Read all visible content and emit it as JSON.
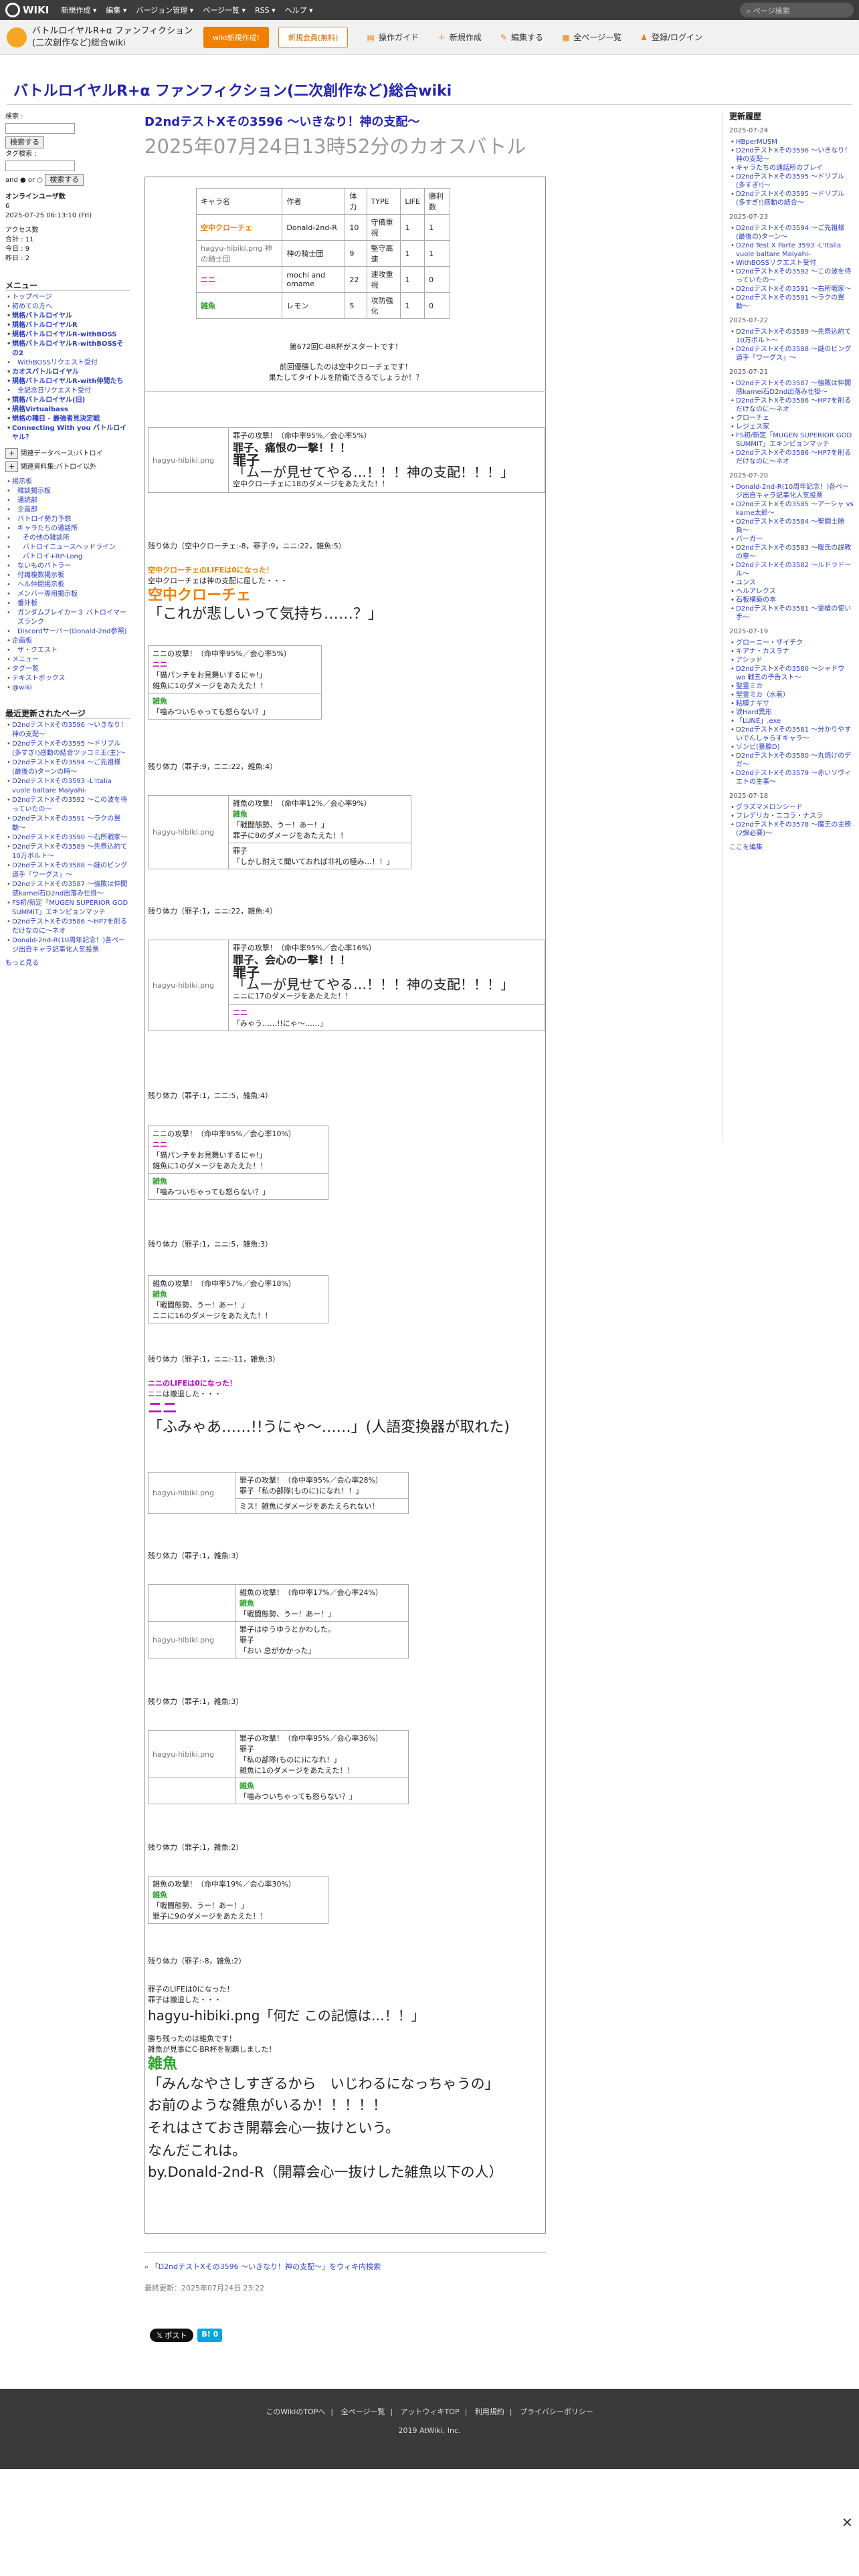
{
  "topbar": {
    "logo": "WIKI",
    "menus": [
      "新規作成 ▾",
      "編集 ▾",
      "バージョン管理 ▾",
      "ページ一覧 ▾",
      "RSS ▾",
      "ヘルプ ▾"
    ],
    "search_placeholder": "ページ検索"
  },
  "header": {
    "site_title": "バトルロイヤルR+α ファンフィクション(二次創作など)総合wiki",
    "btn_new": "wiki新規作成!",
    "btn_member": "新規会員(無料)",
    "nav": [
      "操作ガイド",
      "新規作成",
      "編集する",
      "全ページ一覧",
      "登録/ログイン"
    ]
  },
  "wiki_title": "バトルロイヤルR+α ファンフィクション(二次創作など)総合wiki",
  "sidebar": {
    "search_label": "検索 :",
    "search_btn": "検索する",
    "tag_label": "タグ検索 :",
    "and_or": "and ● or ○",
    "tag_btn": "検索する",
    "online_title": "オンラインユーザ数",
    "online_count": "6",
    "online_time": "2025-07-25 06:13:10 (Fri)",
    "access_title": "アクセス数",
    "access": [
      "合計 : 11",
      "今日 : 9",
      "昨日 : 2"
    ],
    "menu_title": "メニュー",
    "menu": [
      {
        "t": "トップページ",
        "c": ""
      },
      {
        "t": "初めての方へ",
        "c": ""
      },
      {
        "t": "規格バトルロイヤル",
        "c": "b"
      },
      {
        "t": "規格バトルロイヤルR",
        "c": "b"
      },
      {
        "t": "規格バトルロイヤルR-withBOSS",
        "c": "b"
      },
      {
        "t": "規格バトルロイヤルR-withBOSSその2",
        "c": "b"
      },
      {
        "t": "WithBOSSリクエスト受付",
        "c": "sub"
      },
      {
        "t": "カオスバトルロイヤル",
        "c": "b"
      },
      {
        "t": "規格バトルロイヤルR-with仲間たち",
        "c": "b"
      },
      {
        "t": "全記念日リクエスト受付",
        "c": "sub"
      },
      {
        "t": "規格バトルロイヤル(旧)",
        "c": "b"
      },
      {
        "t": "規格Virtualbass",
        "c": "b"
      },
      {
        "t": "規格の種目 - 最強者見決定戦",
        "c": "b"
      },
      {
        "t": "Connecting With you バトルロイヤル？",
        "c": "b"
      }
    ],
    "menu2": [
      "関連データベース:バトロイ",
      "関連資料集:バトロイ以外"
    ],
    "menu3": [
      {
        "t": "掲示板",
        "c": ""
      },
      {
        "t": "雑談掲示板",
        "c": "sub"
      },
      {
        "t": "通読部",
        "c": "sub"
      },
      {
        "t": "企画部",
        "c": "sub"
      },
      {
        "t": "バトロイ勢力予想",
        "c": "sub"
      },
      {
        "t": "キャラたちの通話所",
        "c": "sub"
      },
      {
        "t": "その他の雑談所",
        "c": "sub2"
      },
      {
        "t": "バトロイニュースヘッドライン",
        "c": "sub2"
      },
      {
        "t": "バトロイ+RP-Long",
        "c": "sub2"
      },
      {
        "t": "ないものバトラー",
        "c": "sub"
      },
      {
        "t": "付識複数掲示板",
        "c": "sub"
      },
      {
        "t": "ヘル仲間掲示板",
        "c": "sub"
      },
      {
        "t": "メンバー専用掲示板",
        "c": "sub"
      },
      {
        "t": "番外板",
        "c": "sub"
      },
      {
        "t": "ガンダムブレイカー３ バトロイマーズランク",
        "c": "sub"
      },
      {
        "t": "Discordサーバー(Donald-2nd参照)",
        "c": "sub"
      },
      {
        "t": "企画板",
        "c": ""
      },
      {
        "t": "ザ・クエスト",
        "c": "sub"
      },
      {
        "t": "メニュー",
        "c": ""
      },
      {
        "t": "タグ一覧",
        "c": ""
      },
      {
        "t": "テキストボックス",
        "c": ""
      },
      {
        "t": "@wiki",
        "c": ""
      }
    ],
    "recent_title": "最近更新されたページ",
    "recent": [
      "D2ndテストXその3596 〜いきなり！神の支配〜",
      "D2ndテストXその3595 〜ドリブル(多すぎ!)感動の結合ツッコミ王(主)〜",
      "D2ndテストXその3594 〜ご先祖様(最後の)ターンの時〜",
      "D2ndテストXその3593 -L'Italia vuole baltare Maiyahi-",
      "D2ndテストXその3592 〜この波を待っていたの〜",
      "D2ndテストXその3591 〜ラクの翼動〜",
      "D2ndテストXその3590 〜右所戦家〜",
      "D2ndテストXその3589 〜先祭込約て 10万ボルト〜",
      "D2ndテストXその3588 〜謎のビング道手「ワーグス」〜",
      "D2ndテストXその3587 〜強敗は仲間感kamei石D2nd出落み仕掛〜",
      "FS初/新定「MUGEN SUPERIOR GOD SUMMIT」エキンピョンマッチ",
      "D2ndテストXその3586 〜HP7を削るだけなのに〜ネオ",
      "Donald-2nd-R(10周年記念！)各ページ出自キャラ記事化人気投票"
    ],
    "more": "もっと見る"
  },
  "page": {
    "title": "D2ndテストXその3596 〜いきなり！神の支配〜",
    "subtitle": "2025年07月24日13時52分のカオスバトル"
  },
  "table": {
    "headers": [
      "キャラ名",
      "作者",
      "体力",
      "TYPE",
      "LIFE",
      "勝利数"
    ],
    "rows": [
      [
        "空中クローチェ",
        "Donald-2nd-R",
        "10",
        "守備重視",
        "1",
        "1"
      ],
      [
        "hagyu-hibiki.png 神の騎士団",
        "神の騎士団",
        "9",
        "堅守高速",
        "1",
        "1"
      ],
      [
        "ニニ",
        "mochi and omame",
        "22",
        "速攻重視",
        "1",
        "0"
      ],
      [
        "雑魚",
        "レモン",
        "5",
        "攻防強化",
        "1",
        "0"
      ]
    ]
  },
  "intro": [
    "第672回C-BR杯がスタートです！",
    "前回優勝したのは空中クローチェです！",
    "果たしてタイトルを防衛できるでしょうか！？"
  ],
  "log": {
    "b1_a": "罪子の攻撃！（命中率95%／会心率5%）",
    "b1_b": "罪子、痛恨の一撃！！！",
    "b1_c": "罪子",
    "b1_d": "「ムーが見せてやる…！！！神の支配！！！」",
    "b1_e": "空中クローチェに18のダメージをあたえた！！",
    "r1": "残り体力（空中クローチェ:-8，罪子:9，ニニ:22，雑魚:5）",
    "d1": "空中クローチェのLIFEは0になった！",
    "d2": "空中クローチェは神の支配に屈した・・・",
    "d3": "空中クローチェ",
    "d4": "「これが悲しいって気持ち……？」",
    "b2_a": "ニニの攻撃！（命中率95%／会心率5%）",
    "b2_b": "ニニ",
    "b2_c": "「猫パンチをお見舞いするにゃ!」",
    "b2_d": "雑魚に1のダメージをあたえた！！",
    "b2_e": "雑魚",
    "b2_f": "「噛みついちゃっても怒らない？」",
    "r2": "残り体力（罪子:9，ニニ:22，雑魚:4）",
    "b3_a": "雑魚の攻撃！（命中率12%／会心率9%）",
    "b3_b": "雑魚",
    "b3_c": "「戦闘態勢、うー！あー！」",
    "b3_d": "罪子に8のダメージをあたえた！！",
    "b3_e": "罪子",
    "b3_f": "「しかし耐えて聞いておれば非礼の極み…！！」",
    "r3": "残り体力（罪子:1，ニニ:22，雑魚:4）",
    "b4_a": "罪子の攻撃！（命中率95%／会心率16%）",
    "b4_b": "罪子、会心の一撃！！！",
    "b4_c": "罪子",
    "b4_d": "「ムーが見せてやる…！！！神の支配！！！」",
    "b4_e": "ニニに17のダメージをあたえた！！",
    "b4_f": "ニニ",
    "b4_g": "「みゃう……!!にゃ〜……」",
    "r4": "残り体力（罪子:1，ニニ:5，雑魚:4）",
    "b5_a": "ニニの攻撃！（命中率95%／会心率10%）",
    "b5_b": "ニニ",
    "b5_c": "「猫パンチをお見舞いするにゃ!」",
    "b5_d": "雑魚に1のダメージをあたえた！！",
    "b5_e": "雑魚",
    "b5_f": "「噛みついちゃっても怒らない？」",
    "r5": "残り体力（罪子:1，ニニ:5，雑魚:3）",
    "b6_a": "雑魚の攻撃！（命中率57%／会心率18%）",
    "b6_b": "雑魚",
    "b6_c": "「戦闘態勢、うー！あー！」",
    "b6_d": "ニニに16のダメージをあたえた！！",
    "r6": "残り体力（罪子:1，ニニ:-11，雑魚:3）",
    "d5": "ニニのLIFEは0になった！",
    "d6": "ニニは撤退した・・・",
    "d7": "ニニ",
    "d8": "「ふみゃあ……!!うにゃ〜……」(人語変換器が取れた)",
    "b7_a": "罪子の攻撃！（命中率95%／会心率28%）",
    "b7_b": "罪子「私の部隊(ものに)になれ！！」",
    "b7_c": "ミス！雑魚にダメージをあたえられない！",
    "r7": "残り体力（罪子:1，雑魚:3）",
    "b8_a": "雑魚の攻撃！（命中率17%／会心率24%）",
    "b8_b": "雑魚",
    "b8_c": "「戦闘態勢、うー！あー！」",
    "b8_d": "罪子はゆうゆうとかわした。",
    "b8_e": "罪子",
    "b8_f": "「おい 息がかかった」",
    "r8": "残り体力（罪子:1，雑魚:3）",
    "b9_a": "罪子の攻撃！（命中率95%／会心率36%）",
    "b9_b": "罪子",
    "b9_c": "「私の部隊(ものに)になれ！」",
    "b9_d": "雑魚に1のダメージをあたえた！！",
    "b9_e": "雑魚",
    "b9_f": "「噛みついちゃっても怒らない？」",
    "r9": "残り体力（罪子:1，雑魚:2）",
    "b10_a": "雑魚の攻撃！（命中率19%／会心率30%）",
    "b10_b": "雑魚",
    "b10_c": "「戦闘態勢、うー！あー！」",
    "b10_d": "罪子に9のダメージをあたえた！！",
    "r10": "残り体力（罪子:-8，雑魚:2）",
    "e1": "罪子のLIFEは0になった！",
    "e2": "罪子は撤退した・・・",
    "e3": "hagyu-hibiki.png「何だ この記憶は…！！」",
    "e4": "勝ち残ったのは雑魚です！",
    "e5": "雑魚が見事にC-BR杯を制覇しました！",
    "e6": "雑魚",
    "e7": "「みんなやさしすぎるから　いじわるになっちゃうの」",
    "e8": "お前のような雑魚がいるか！！！！！",
    "e9": "それはさておき開幕会心一抜けという。",
    "e10": "なんだこれは。",
    "e11": "by.Donald-2nd-R（開幕会心一抜けした雑魚以下の人）"
  },
  "hagyu": "hagyu-hibiki.png",
  "below": {
    "link": "「D2ndテストXその3596 〜いきなり！神の支配〜」をウィキ内検索",
    "updated": "最終更新：2025年07月24日 23:22",
    "tweet": "ポスト",
    "hatena": "B! 0"
  },
  "rightbar": {
    "title": "更新履歴",
    "groups": [
      {
        "date": "2025-07-24",
        "items": [
          "HBperMUSM",
          "D2ndテストXその3596 〜いきなり！神の支配〜",
          "キャラたちの通話所のブレイ",
          "D2ndテストXその3595 〜ドリブル(多すぎ!)〜",
          "D2ndテストXその3595 〜ドリブル(多すぎ!)感動の結合〜"
        ]
      },
      {
        "date": "2025-07-23",
        "items": [
          "D2ndテストXその3594 〜ご先祖様(最後の)ターン〜",
          "D2nd Test X Parte 3593 -L'Italia vuole baltare Maiyahi-",
          "WithBOSSリクエスト受付",
          "D2ndテストXその3592 〜この波を待っていたの〜",
          "D2ndテストXその3591 〜右所戦家〜",
          "D2ndテストXその3591 〜ラクの翼動〜"
        ]
      },
      {
        "date": "2025-07-22",
        "items": [
          "D2ndテストXその3589 〜先祭込約て 10万ボルト〜",
          "D2ndテストXその3588 〜謎のビング道手「ワーグス」〜"
        ]
      },
      {
        "date": "2025-07-21",
        "items": [
          "D2ndテストXその3587 〜強敗は仲間感kamei石D2nd出落み仕掛〜",
          "D2ndテストXその3586 〜HP7を削るだけなのに〜ネオ",
          "クローチェ",
          "レジェス家",
          "FS初/新定「MUGEN SUPERIOR GOD SUMMIT」エキンピョンマッチ",
          "D2ndテストXその3586 〜HP7を削るだけなのに〜ネオ"
        ]
      },
      {
        "date": "2025-07-20",
        "items": [
          "Donald-2nd-R(10周年記念！)各ページ出自キャラ記事化人気投票",
          "D2ndテストXその3585 〜アーシャ vs kame太郎〜",
          "D2ndテストXその3584 〜聖闘士勝負〜",
          "バーガー",
          "D2ndテストXその3583 〜暖氏の説教の章〜",
          "D2ndテストXその3582 〜ルドラドール〜",
          "ユンス",
          "ヘルアレクス",
          "石板構築の本",
          "D2ndテストXその3581 〜霊槍の使い手〜"
        ]
      },
      {
        "date": "2025-07-19",
        "items": [
          "グローニー・ザイチク",
          "キアナ・カスラナ",
          "アシッド",
          "D2ndテストXその3580 〜シャドウ wo 戦五の予告スト〜",
          "聖霊ミカ",
          "聖霊ミカ（水着）",
          "粘膜ナギサ",
          "涙Hard異形",
          "「LUNE」.exe",
          "D2ndテストXその3581 〜分かりやすいでんしゃらすキャラ〜",
          "ゾンビ(暴腺D)",
          "D2ndテストXその3580 〜丸焼けのデガ〜",
          "D2ndテストXその3579 〜赤いソヴィエトの主事〜"
        ]
      },
      {
        "date": "2025-07-18",
        "items": [
          "グラズマメロンシード",
          "フレデリカ・ニコラ・ナスラ",
          "D2ndテストXその3578 〜魔王の主務 (2弾必要)〜"
        ]
      }
    ],
    "edit": "ここを編集"
  },
  "footer": {
    "links": [
      "このWikiのTOPへ",
      "全ページ一覧",
      "アットウィキTOP",
      "利用規約",
      "プライバシーポリシー"
    ],
    "copy": "2019 AtWiki, Inc."
  }
}
